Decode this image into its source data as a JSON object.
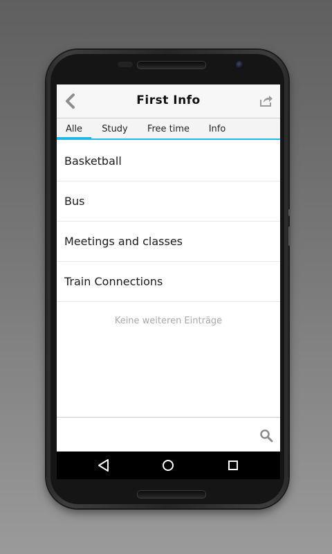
{
  "header": {
    "title": "First Info",
    "back_icon": "chevron-left-icon",
    "share_icon": "share-icon"
  },
  "tabs": [
    {
      "label": "Alle",
      "active": true
    },
    {
      "label": "Study",
      "active": false
    },
    {
      "label": "Free time",
      "active": false
    },
    {
      "label": "Info",
      "active": false
    }
  ],
  "list": {
    "items": [
      {
        "label": "Basketball"
      },
      {
        "label": "Bus"
      },
      {
        "label": "Meetings and classes"
      },
      {
        "label": "Train Connections"
      }
    ],
    "empty_message": "Keine weiteren Einträge"
  },
  "search": {
    "value": "",
    "icon": "search-icon"
  },
  "navbar": {
    "back_icon": "nav-back-icon",
    "home_icon": "nav-home-icon",
    "recents_icon": "nav-recents-icon"
  },
  "colors": {
    "accent": "#20b8e6",
    "titlebar_bg": "#f7f7f7",
    "tabbar_bg": "#f4f4f4",
    "muted_text": "#a8a8a8"
  }
}
